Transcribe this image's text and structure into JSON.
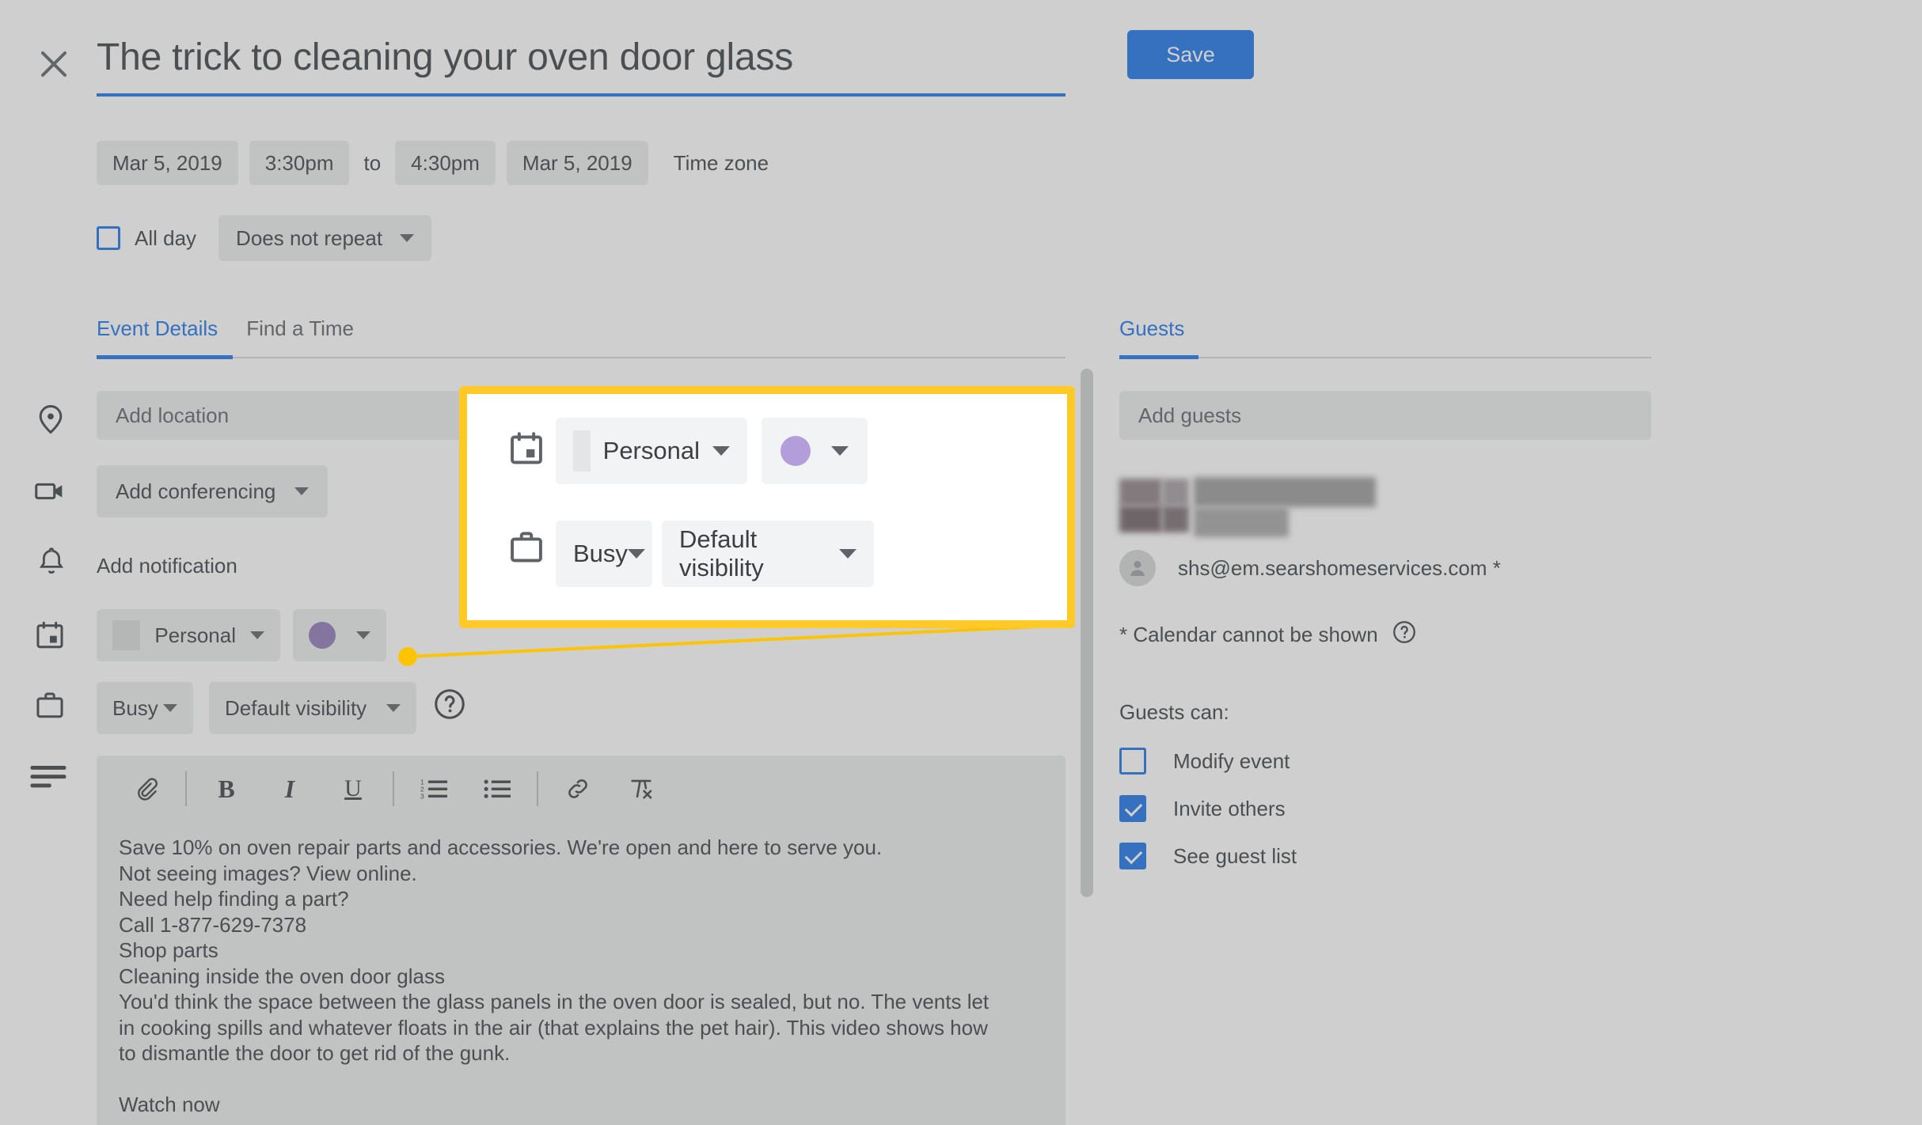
{
  "header": {
    "close_icon": "close-icon",
    "title": "The trick to cleaning your oven door glass",
    "save_label": "Save",
    "accent_blue": "#1a73e8",
    "highlight_yellow": "#FFCA28"
  },
  "datetime": {
    "start_date": "Mar 5, 2019",
    "start_time": "3:30pm",
    "to_label": "to",
    "end_time": "4:30pm",
    "end_date": "Mar 5, 2019",
    "timezone_label": "Time zone"
  },
  "recurrence": {
    "all_day_label": "All day",
    "all_day_checked": false,
    "repeat_label": "Does not repeat"
  },
  "tabs": {
    "left": [
      {
        "label": "Event Details",
        "active": true
      },
      {
        "label": "Find a Time",
        "active": false
      }
    ],
    "right": [
      {
        "label": "Guests",
        "active": true
      }
    ]
  },
  "form": {
    "location_placeholder": "Add location",
    "conferencing_label": "Add conferencing",
    "notification_label": "Add notification",
    "calendar_label": "Personal",
    "color_swatch": "#b39ddb",
    "busy_label": "Busy",
    "visibility_label": "Default visibility",
    "help_icon": "help-circle-icon"
  },
  "description": {
    "toolbar": [
      {
        "name": "attach-icon",
        "label": "Attach"
      },
      {
        "name": "bold-icon",
        "label": "B"
      },
      {
        "name": "italic-icon",
        "label": "I"
      },
      {
        "name": "underline-icon",
        "label": "U"
      },
      {
        "name": "numbered-list-icon",
        "label": "Numbered list"
      },
      {
        "name": "bulleted-list-icon",
        "label": "Bulleted list"
      },
      {
        "name": "link-icon",
        "label": "Insert link"
      },
      {
        "name": "clear-formatting-icon",
        "label": "Remove formatting"
      }
    ],
    "body": "Save 10% on oven repair parts and accessories. We're open and here to serve you.\nNot seeing images? View online.\nNeed help finding a part?\nCall 1-877-629-7378\nShop parts\nCleaning inside the oven door glass\nYou'd think the space between the glass panels in the oven door is sealed, but no. The vents let\nin cooking spills and whatever floats in the air (that explains the pet hair). This video shows how\nto dismantle the door to get rid of the gunk.\n\nWatch now"
  },
  "guests": {
    "add_placeholder": "Add guests",
    "guest_email": "shs@em.searshomeservices.com *",
    "calendar_note": "* Calendar cannot be shown",
    "note_help_icon": "help-circle-icon",
    "guests_can_label": "Guests can:",
    "permissions": [
      {
        "label": "Modify event",
        "checked": false
      },
      {
        "label": "Invite others",
        "checked": true
      },
      {
        "label": "See guest list",
        "checked": true
      }
    ]
  },
  "callout": {
    "calendar_icon": "calendar-icon",
    "busy_icon": "briefcase-icon",
    "calendar_label": "Personal",
    "color_swatch": "#b39ddb",
    "busy_label": "Busy",
    "visibility_label": "Default visibility"
  }
}
